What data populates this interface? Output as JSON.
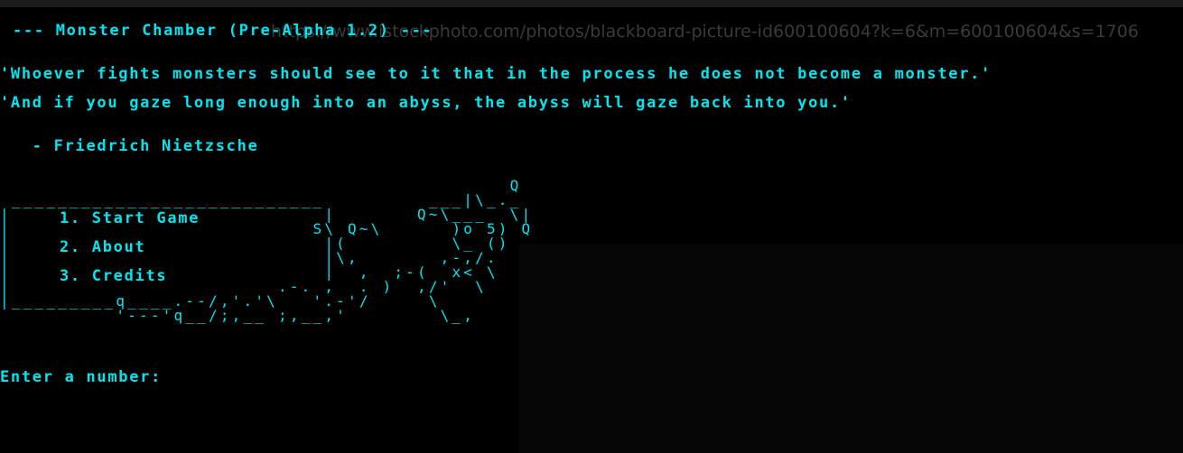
{
  "title": "--- Monster Chamber (Pre-Alpha 1.2) ---",
  "background_url": "https://www.istockphoto.com/photos/blackboard-picture-id600100604?k=6&m=600100604&s=1706",
  "quote": {
    "line1": "'Whoever fights monsters should see to it that in the process he does not become a monster.'",
    "line2": "'And if you gaze long enough into an abyss, the abyss will gaze back into you.'",
    "author": "   - Friedrich Nietzsche"
  },
  "menu": {
    "items": [
      {
        "label": "1. Start Game"
      },
      {
        "label": "2. About"
      },
      {
        "label": "3. Credits"
      }
    ]
  },
  "ascii_art": "                                            Q\n ___________________________         ___|\\_._\n|                           |       Q~\\___  \\|\n|                          S\\ Q~\\      )o 5) Q\n|                           |(         \\_ ()\n|                           |\\,       ,-,/.\n|                           |  ,  ;-(  x< \\\n|                       .-. ,  . )  ,/'  \\\n|_________q____.--/,'.'\\   '.-'/     \\\n          '---'q__/;,__ ;,__,'        \\_,",
  "prompt": "Enter a number:",
  "colors": {
    "text": "#00e5ee",
    "background": "#000000"
  }
}
